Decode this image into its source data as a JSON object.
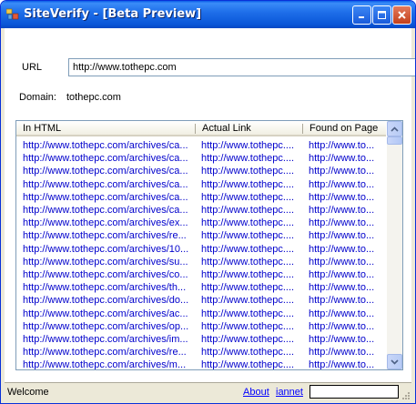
{
  "window": {
    "title": "SiteVerify - [Beta Preview]"
  },
  "form": {
    "url_label": "URL",
    "url_value": "http://www.tothepc.com",
    "domain_label": "Domain:",
    "domain_value": "tothepc.com"
  },
  "list": {
    "columns": [
      "In HTML",
      "Actual Link",
      "Found on Page"
    ],
    "rows": [
      [
        "http://www.tothepc.com/archives/ca...",
        "http://www.tothepc....",
        "http://www.to..."
      ],
      [
        "http://www.tothepc.com/archives/ca...",
        "http://www.tothepc....",
        "http://www.to..."
      ],
      [
        "http://www.tothepc.com/archives/ca...",
        "http://www.tothepc....",
        "http://www.to..."
      ],
      [
        "http://www.tothepc.com/archives/ca...",
        "http://www.tothepc....",
        "http://www.to..."
      ],
      [
        "http://www.tothepc.com/archives/ca...",
        "http://www.tothepc....",
        "http://www.to..."
      ],
      [
        "http://www.tothepc.com/archives/ca...",
        "http://www.tothepc....",
        "http://www.to..."
      ],
      [
        "http://www.tothepc.com/archives/ex...",
        "http://www.tothepc....",
        "http://www.to..."
      ],
      [
        "http://www.tothepc.com/archives/re...",
        "http://www.tothepc....",
        "http://www.to..."
      ],
      [
        "http://www.tothepc.com/archives/10...",
        "http://www.tothepc....",
        "http://www.to..."
      ],
      [
        "http://www.tothepc.com/archives/su...",
        "http://www.tothepc....",
        "http://www.to..."
      ],
      [
        "http://www.tothepc.com/archives/co...",
        "http://www.tothepc....",
        "http://www.to..."
      ],
      [
        "http://www.tothepc.com/archives/th...",
        "http://www.tothepc....",
        "http://www.to..."
      ],
      [
        "http://www.tothepc.com/archives/do...",
        "http://www.tothepc....",
        "http://www.to..."
      ],
      [
        "http://www.tothepc.com/archives/ac...",
        "http://www.tothepc....",
        "http://www.to..."
      ],
      [
        "http://www.tothepc.com/archives/op...",
        "http://www.tothepc....",
        "http://www.to..."
      ],
      [
        "http://www.tothepc.com/archives/im...",
        "http://www.tothepc....",
        "http://www.to..."
      ],
      [
        "http://www.tothepc.com/archives/re...",
        "http://www.tothepc....",
        "http://www.to..."
      ],
      [
        "http://www.tothepc.com/archives/m...",
        "http://www.tothepc....",
        "http://www.to..."
      ]
    ]
  },
  "status": {
    "welcome": "Welcome",
    "about_link": "About",
    "iannet_link": "iannet"
  },
  "colors": {
    "link_blue": "#0000CC",
    "titlebar_blue": "#0A57D8",
    "window_face": "#ECE9D8"
  }
}
